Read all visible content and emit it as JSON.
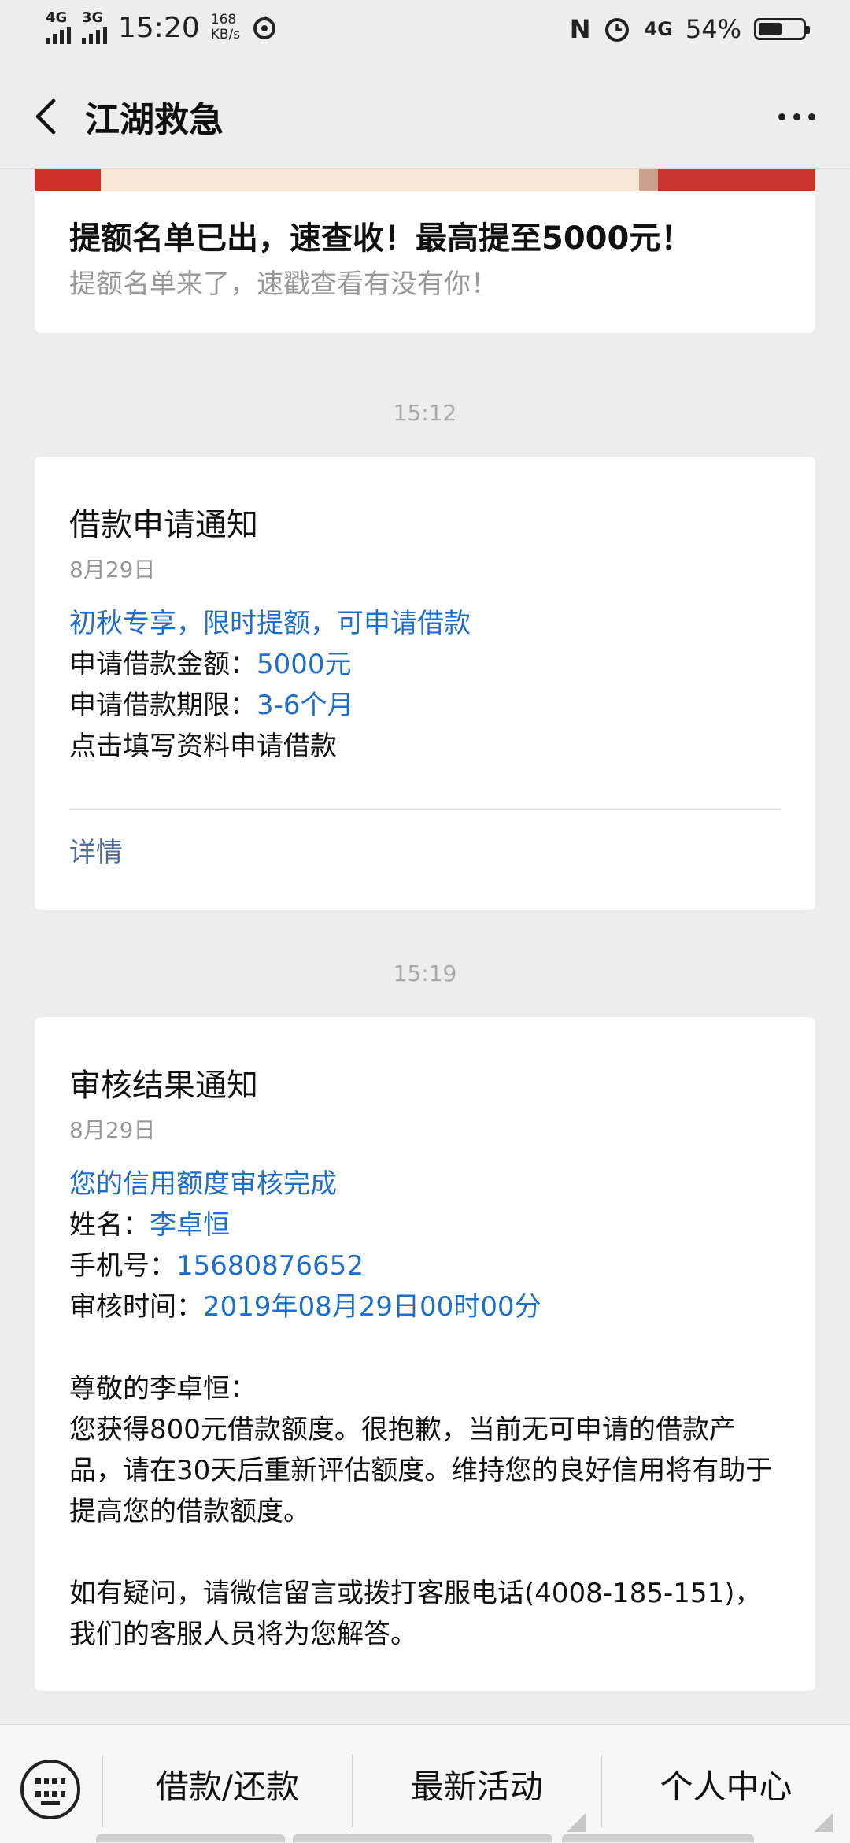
{
  "status_bar": {
    "signal1": "4G",
    "signal2": "3G",
    "time": "15:20",
    "speed_value": "168",
    "speed_unit": "KB/s",
    "nfc": "N",
    "net": "4G",
    "battery": "54%",
    "battery_level": 0.54
  },
  "header": {
    "title": "江湖救急"
  },
  "promo": {
    "title": "提额名单已出，速查收！最高提至5000元！",
    "subtitle": "提额名单来了，速戳查看有没有你！"
  },
  "messages": [
    {
      "time": "15:12",
      "title": "借款申请通知",
      "date": "8月29日",
      "highlight": "初秋专享，限时提额，可申请借款",
      "amount_label": "申请借款金额：",
      "amount_value": "5000元",
      "term_label": "申请借款期限：",
      "term_value": "3-6个月",
      "action_text": "点击填写资料申请借款",
      "detail": "详情"
    },
    {
      "time": "15:19",
      "title": "审核结果通知",
      "date": "8月29日",
      "highlight": "您的信用额度审核完成",
      "name_label": "姓名：",
      "name_value": "李卓恒",
      "phone_label": "手机号：",
      "phone_value": "15680876652",
      "review_label": "审核时间：",
      "review_value": "2019年08月29日00时00分",
      "greeting": "尊敬的李卓恒：",
      "body1": "您获得800元借款额度。很抱歉，当前无可申请的借款产品，请在30天后重新评估额度。维持您的良好信用将有助于提高您的借款额度。",
      "body2": "如有疑问，请微信留言或拨打客服电话(4008-185-151)，我们的客服人员将为您解答。"
    }
  ],
  "bottom_menu": {
    "items": [
      "借款/还款",
      "最新活动",
      "个人中心"
    ]
  }
}
